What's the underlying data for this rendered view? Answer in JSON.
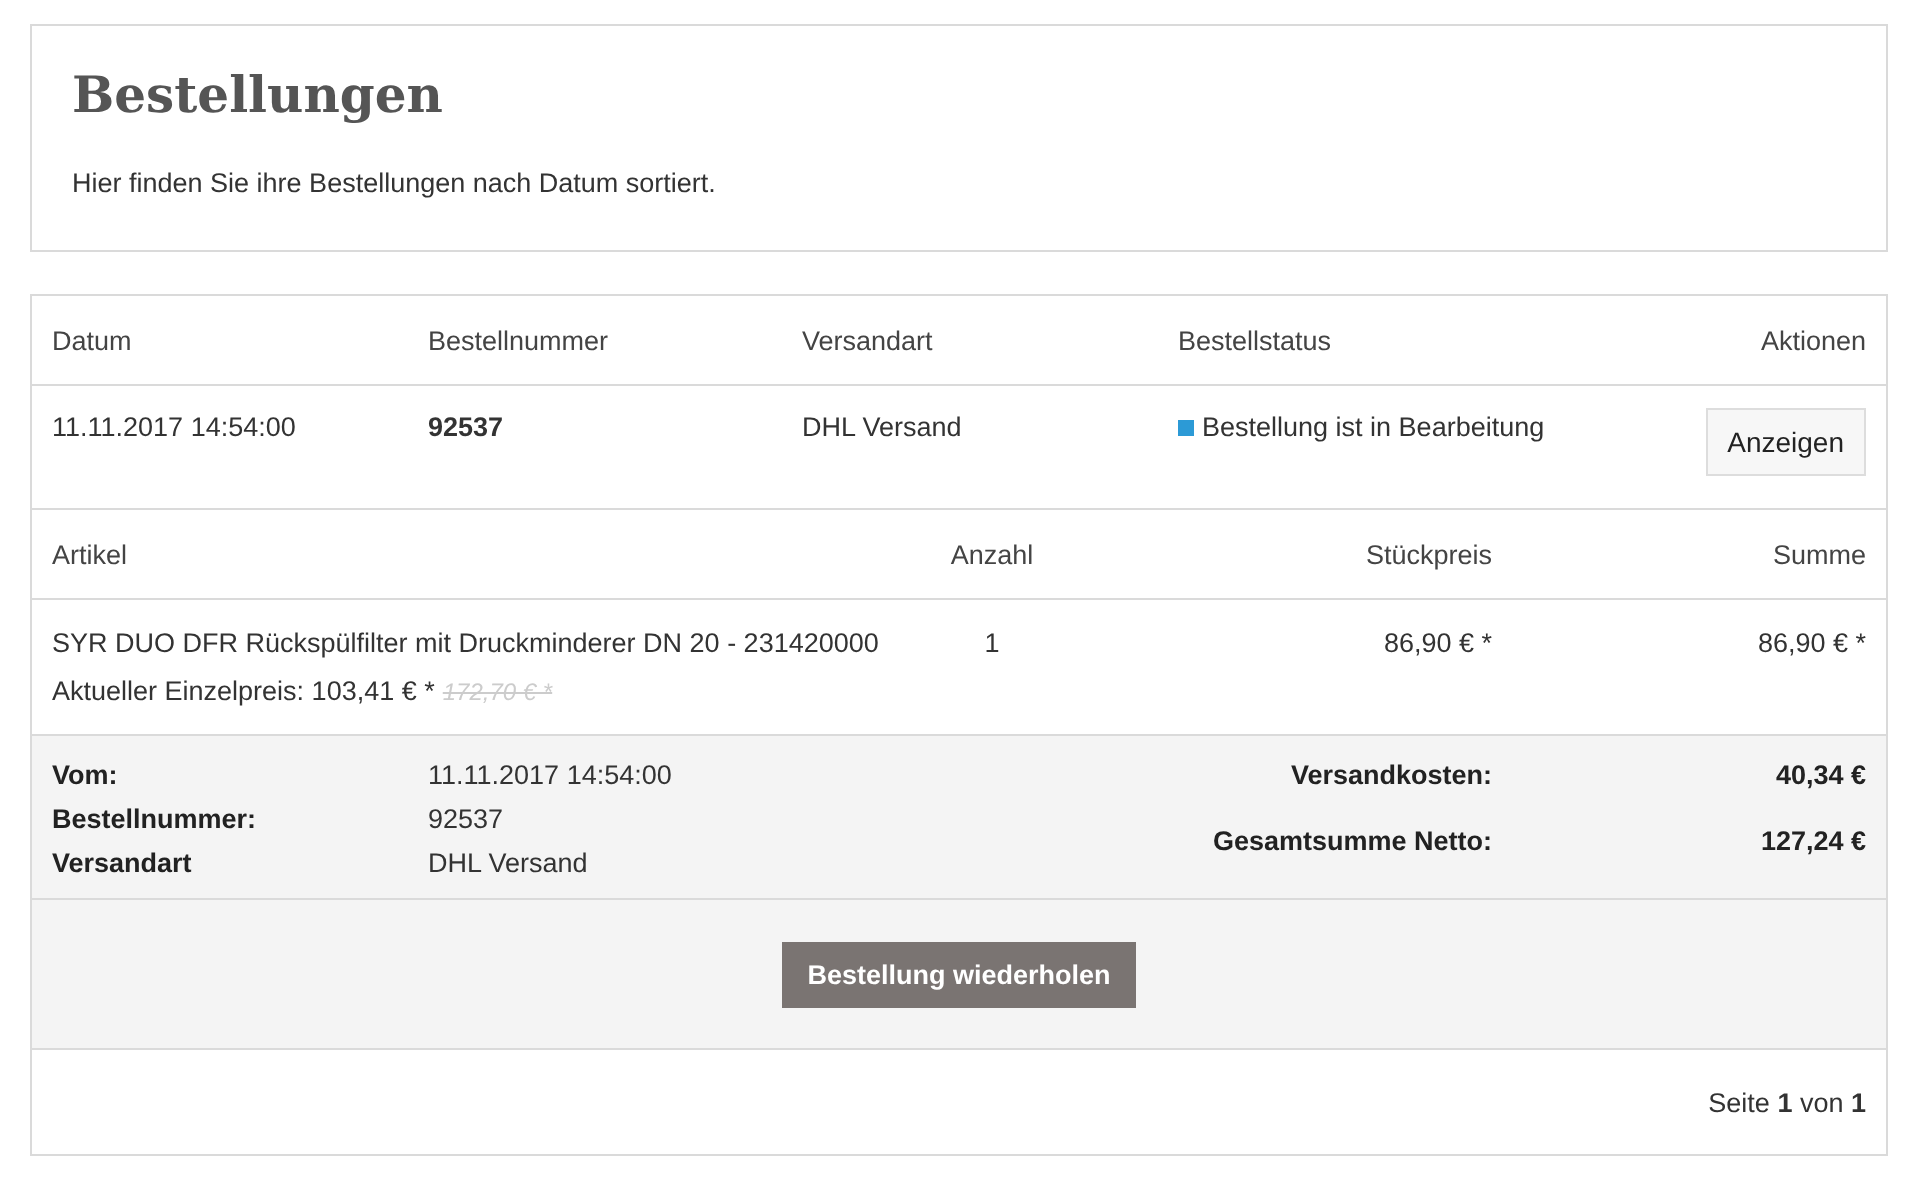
{
  "header": {
    "title": "Bestellungen",
    "description": "Hier finden Sie ihre Bestellungen nach Datum sortiert."
  },
  "orders_table": {
    "columns": [
      "Datum",
      "Bestellnummer",
      "Versandart",
      "Bestellstatus",
      "Aktionen"
    ],
    "rows": [
      {
        "date": "11.11.2017 14:54:00",
        "order_number": "92537",
        "shipping": "DHL Versand",
        "status": {
          "text": "Bestellung ist in Bearbeitung",
          "color": "#2c9ad6"
        },
        "action": "Anzeigen"
      }
    ]
  },
  "items_table": {
    "columns": [
      "Artikel",
      "Anzahl",
      "Stückpreis",
      "Summe"
    ],
    "rows": [
      {
        "name": "SYR DUO DFR Rückspülfilter mit Druckminderer DN 20 - 231420000",
        "current_price": "Aktueller Einzelpreis: 103,41 € *",
        "old_price": "172,70 € *",
        "quantity": "1",
        "unit_price": "86,90 € *",
        "total": "86,90 € *"
      }
    ]
  },
  "summary": {
    "left": [
      {
        "label": "Vom:",
        "value": "11.11.2017 14:54:00"
      },
      {
        "label": "Bestellnummer:",
        "value": "92537"
      },
      {
        "label": "Versandart",
        "value": "DHL Versand"
      }
    ],
    "right": [
      {
        "label": "Versandkosten:",
        "value": "40,34 €"
      },
      {
        "label": "Gesamtsumme Netto:",
        "value": "127,24 €"
      }
    ]
  },
  "repeat_button": "Bestellung wiederholen",
  "pagination": "Seite **1** von **1**"
}
